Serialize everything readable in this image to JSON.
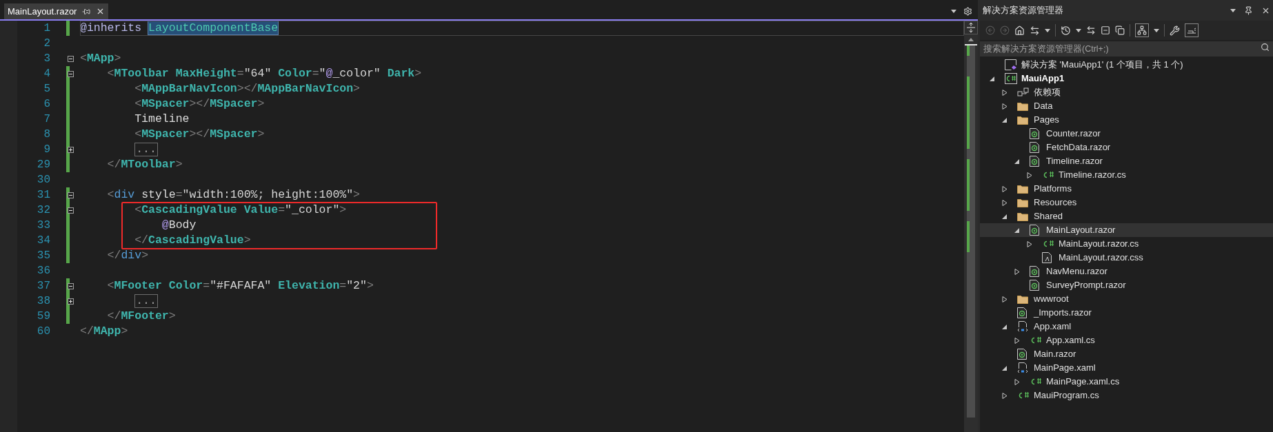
{
  "editor": {
    "tab": {
      "title": "MainLayout.razor",
      "selected": true
    },
    "lines": [
      {
        "number": "1",
        "changed": true,
        "current": true,
        "boxed": false,
        "tokens": [
          {
            "kind": "directive",
            "text": "@inherits "
          },
          {
            "kind": "type",
            "text": "LayoutComponentBase"
          }
        ]
      },
      {
        "number": "2",
        "changed": false,
        "current": false,
        "boxed": false
      },
      {
        "number": "3",
        "changed": false,
        "current": false,
        "boxed": false,
        "expanded": true,
        "tokens": [
          {
            "kind": "punct",
            "text": "<"
          },
          {
            "kind": "tag",
            "text": "MApp"
          },
          {
            "kind": "punct",
            "text": ">"
          }
        ]
      },
      {
        "number": "4",
        "changed": true,
        "current": false,
        "boxed": false,
        "expanded": true,
        "tokens": [
          {
            "kind": "punct",
            "text": "    <"
          },
          {
            "kind": "tag",
            "text": "MToolbar"
          },
          {
            "kind": "attr",
            "text": " MaxHeight"
          },
          {
            "kind": "punct",
            "text": "="
          },
          {
            "kind": "string",
            "text": "\"64\""
          },
          {
            "kind": "attr",
            "text": " Color"
          },
          {
            "kind": "punct",
            "text": "="
          },
          {
            "kind": "string",
            "text": "\""
          },
          {
            "kind": "at",
            "text": "@"
          },
          {
            "kind": "string",
            "text": "_color\""
          },
          {
            "kind": "attr",
            "text": " Dark"
          },
          {
            "kind": "punct",
            "text": ">"
          }
        ]
      },
      {
        "number": "5",
        "changed": true,
        "current": false,
        "boxed": false,
        "tokens": [
          {
            "kind": "punct",
            "text": "        <"
          },
          {
            "kind": "tag",
            "text": "MAppBarNavIcon"
          },
          {
            "kind": "punct",
            "text": "></"
          },
          {
            "kind": "tag",
            "text": "MAppBarNavIcon"
          },
          {
            "kind": "punct",
            "text": ">"
          }
        ]
      },
      {
        "number": "6",
        "changed": true,
        "current": false,
        "boxed": false,
        "tokens": [
          {
            "kind": "punct",
            "text": "        <"
          },
          {
            "kind": "tag",
            "text": "MSpacer"
          },
          {
            "kind": "punct",
            "text": "></"
          },
          {
            "kind": "tag",
            "text": "MSpacer"
          },
          {
            "kind": "punct",
            "text": ">"
          }
        ]
      },
      {
        "number": "7",
        "changed": true,
        "current": false,
        "boxed": false,
        "tokens": [
          {
            "kind": "text",
            "text": "        Timeline"
          }
        ]
      },
      {
        "number": "8",
        "changed": true,
        "current": false,
        "boxed": false,
        "tokens": [
          {
            "kind": "punct",
            "text": "        <"
          },
          {
            "kind": "tag",
            "text": "MSpacer"
          },
          {
            "kind": "punct",
            "text": "></"
          },
          {
            "kind": "tag",
            "text": "MSpacer"
          },
          {
            "kind": "punct",
            "text": ">"
          }
        ]
      },
      {
        "number": "9",
        "changed": true,
        "current": false,
        "boxed": false,
        "expanded": false,
        "tokens": [
          {
            "kind": "collapsed",
            "text": "        ..."
          }
        ]
      },
      {
        "number": "29",
        "changed": true,
        "current": false,
        "boxed": false,
        "tokens": [
          {
            "kind": "punct",
            "text": "    </"
          },
          {
            "kind": "tag",
            "text": "MToolbar"
          },
          {
            "kind": "punct",
            "text": ">"
          }
        ]
      },
      {
        "number": "30",
        "changed": false,
        "current": false,
        "boxed": false
      },
      {
        "number": "31",
        "changed": true,
        "current": false,
        "boxed": false,
        "expanded": true,
        "tokens": [
          {
            "kind": "punct",
            "text": "    <"
          },
          {
            "kind": "keyword",
            "text": "div"
          },
          {
            "kind": "text",
            "text": " style"
          },
          {
            "kind": "punct",
            "text": "="
          },
          {
            "kind": "string",
            "text": "\"width:100%; height:100%\""
          },
          {
            "kind": "punct",
            "text": ">"
          }
        ]
      },
      {
        "number": "32",
        "changed": true,
        "current": false,
        "boxed": true,
        "expanded": true,
        "tokens": [
          {
            "kind": "punct",
            "text": "        <"
          },
          {
            "kind": "tag",
            "text": "CascadingValue"
          },
          {
            "kind": "attr",
            "text": " Value"
          },
          {
            "kind": "punct",
            "text": "="
          },
          {
            "kind": "string",
            "text": "\"_color\""
          },
          {
            "kind": "punct",
            "text": ">"
          }
        ]
      },
      {
        "number": "33",
        "changed": true,
        "current": false,
        "boxed": true,
        "tokens": [
          {
            "kind": "at",
            "text": "            @"
          },
          {
            "kind": "text",
            "text": "Body"
          }
        ]
      },
      {
        "number": "34",
        "changed": true,
        "current": false,
        "boxed": true,
        "tokens": [
          {
            "kind": "punct",
            "text": "        </"
          },
          {
            "kind": "tag",
            "text": "CascadingValue"
          },
          {
            "kind": "punct",
            "text": ">"
          }
        ]
      },
      {
        "number": "35",
        "changed": true,
        "current": false,
        "boxed": false,
        "tokens": [
          {
            "kind": "punct",
            "text": "    </"
          },
          {
            "kind": "keyword",
            "text": "div"
          },
          {
            "kind": "punct",
            "text": ">"
          }
        ]
      },
      {
        "number": "36",
        "changed": false,
        "current": false,
        "boxed": false
      },
      {
        "number": "37",
        "changed": true,
        "current": false,
        "boxed": false,
        "expanded": true,
        "tokens": [
          {
            "kind": "punct",
            "text": "    <"
          },
          {
            "kind": "tag",
            "text": "MFooter"
          },
          {
            "kind": "attr",
            "text": " Color"
          },
          {
            "kind": "punct",
            "text": "="
          },
          {
            "kind": "string",
            "text": "\"#FAFAFA\""
          },
          {
            "kind": "attr",
            "text": " Elevation"
          },
          {
            "kind": "punct",
            "text": "="
          },
          {
            "kind": "string",
            "text": "\"2\""
          },
          {
            "kind": "punct",
            "text": ">"
          }
        ]
      },
      {
        "number": "38",
        "changed": true,
        "current": false,
        "boxed": false,
        "expanded": false,
        "tokens": [
          {
            "kind": "collapsed",
            "text": "        ..."
          }
        ]
      },
      {
        "number": "59",
        "changed": true,
        "current": false,
        "boxed": false,
        "tokens": [
          {
            "kind": "punct",
            "text": "    </"
          },
          {
            "kind": "tag",
            "text": "MFooter"
          },
          {
            "kind": "punct",
            "text": ">"
          }
        ]
      },
      {
        "number": "60",
        "changed": false,
        "current": false,
        "boxed": false,
        "tokens": [
          {
            "kind": "punct",
            "text": "</"
          },
          {
            "kind": "tag",
            "text": "MApp"
          },
          {
            "kind": "punct",
            "text": ">"
          }
        ]
      }
    ]
  },
  "explorer": {
    "title": "解决方案资源管理器",
    "search": {
      "placeholder": "搜索解决方案资源管理器(Ctrl+;)"
    },
    "tree": [
      {
        "label": "解决方案 'MauiApp1' (1 个项目，共 1 个)",
        "kind": "solution",
        "selected": false
      },
      {
        "label": "MauiApp1",
        "kind": "project",
        "expanded": true,
        "selected": false,
        "children": [
          {
            "label": "依赖项",
            "kind": "deps",
            "expanded": false,
            "selected": false
          },
          {
            "label": "Data",
            "kind": "folder",
            "expanded": false,
            "selected": false
          },
          {
            "label": "Pages",
            "kind": "folder",
            "expanded": true,
            "selected": false,
            "children": [
              {
                "label": "Counter.razor",
                "kind": "razor",
                "selected": false
              },
              {
                "label": "FetchData.razor",
                "kind": "razor",
                "selected": false
              },
              {
                "label": "Timeline.razor",
                "kind": "razor",
                "expanded": true,
                "selected": false,
                "children": [
                  {
                    "label": "Timeline.razor.cs",
                    "kind": "cs",
                    "expanded": false,
                    "selected": false
                  }
                ]
              }
            ]
          },
          {
            "label": "Platforms",
            "kind": "folder",
            "expanded": false,
            "selected": false
          },
          {
            "label": "Resources",
            "kind": "folder",
            "expanded": false,
            "selected": false
          },
          {
            "label": "Shared",
            "kind": "folder",
            "expanded": true,
            "selected": false,
            "children": [
              {
                "label": "MainLayout.razor",
                "kind": "razor",
                "expanded": true,
                "selected": true,
                "children": [
                  {
                    "label": "MainLayout.razor.cs",
                    "kind": "cs",
                    "expanded": false,
                    "selected": false
                  },
                  {
                    "label": "MainLayout.razor.css",
                    "kind": "css",
                    "selected": false
                  }
                ]
              },
              {
                "label": "NavMenu.razor",
                "kind": "razor",
                "expanded": false,
                "selected": false
              },
              {
                "label": "SurveyPrompt.razor",
                "kind": "razor",
                "selected": false
              }
            ]
          },
          {
            "label": "wwwroot",
            "kind": "folder",
            "expanded": false,
            "selected": false
          },
          {
            "label": "_Imports.razor",
            "kind": "razor",
            "selected": false
          },
          {
            "label": "App.xaml",
            "kind": "xaml",
            "expanded": true,
            "selected": false,
            "children": [
              {
                "label": "App.xaml.cs",
                "kind": "cs",
                "expanded": false,
                "selected": false
              }
            ]
          },
          {
            "label": "Main.razor",
            "kind": "razor",
            "selected": false
          },
          {
            "label": "MainPage.xaml",
            "kind": "xaml",
            "expanded": true,
            "selected": false,
            "children": [
              {
                "label": "MainPage.xaml.cs",
                "kind": "cs",
                "expanded": false,
                "selected": false
              }
            ]
          },
          {
            "label": "MauiProgram.cs",
            "kind": "cs",
            "expanded": false,
            "selected": false
          }
        ]
      }
    ]
  }
}
